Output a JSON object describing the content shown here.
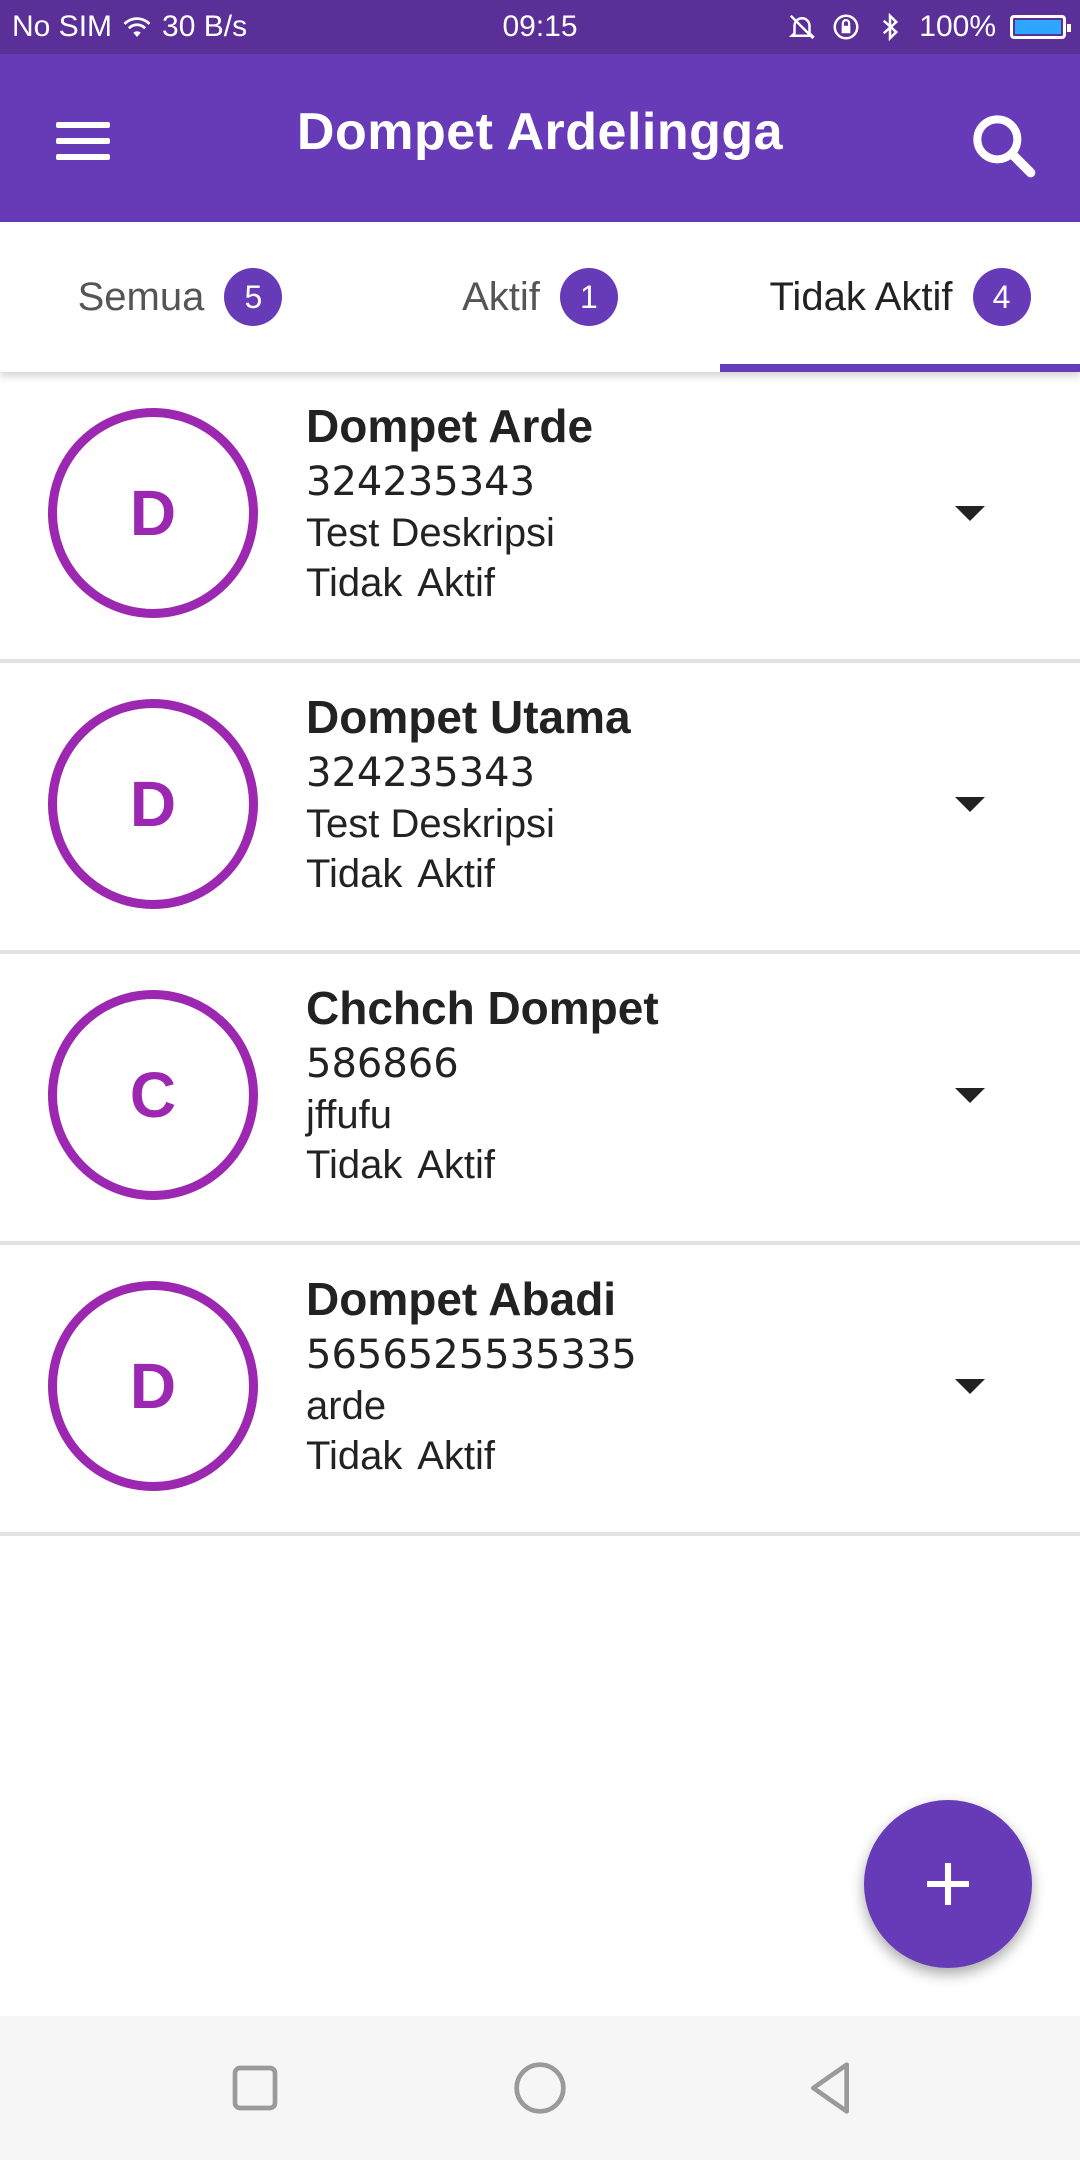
{
  "status_bar": {
    "carrier": "No SIM",
    "speed": "30 B/s",
    "time": "09:15",
    "battery": "100%",
    "icons": [
      "wifi-icon",
      "mute-icon",
      "rotation-lock-icon",
      "bluetooth-icon",
      "battery-icon"
    ]
  },
  "app_bar": {
    "title": "Dompet Ardelingga",
    "menu_icon": "hamburger-menu-icon",
    "search_icon": "search-icon"
  },
  "tabs": [
    {
      "label": "Semua",
      "count": "5",
      "active": false
    },
    {
      "label": "Aktif",
      "count": "1",
      "active": false
    },
    {
      "label": "Tidak Aktif",
      "count": "4",
      "active": true
    }
  ],
  "wallets": [
    {
      "initial": "D",
      "name": "Dompet Arde",
      "number": "324235343",
      "description": "Test Deskripsi",
      "status": "Tidak  Aktif"
    },
    {
      "initial": "D",
      "name": "Dompet Utama",
      "number": "324235343",
      "description": "Test Deskripsi",
      "status": "Tidak  Aktif"
    },
    {
      "initial": "C",
      "name": "Chchch Dompet",
      "number": "586866",
      "description": "jffufu",
      "status": "Tidak  Aktif"
    },
    {
      "initial": "D",
      "name": "Dompet Abadi",
      "number": "5656525535335",
      "description": "arde",
      "status": "Tidak  Aktif"
    }
  ],
  "fab": {
    "icon": "plus-icon"
  },
  "nav_bar": {
    "icons": [
      "recent-apps-icon",
      "home-icon",
      "back-icon"
    ]
  },
  "colors": {
    "primary": "#673ab7",
    "status_bar": "#5b2f98",
    "avatar_ring": "#9c27b0",
    "divider": "#e2e2e2",
    "battery_fill": "#2fa6ff"
  }
}
